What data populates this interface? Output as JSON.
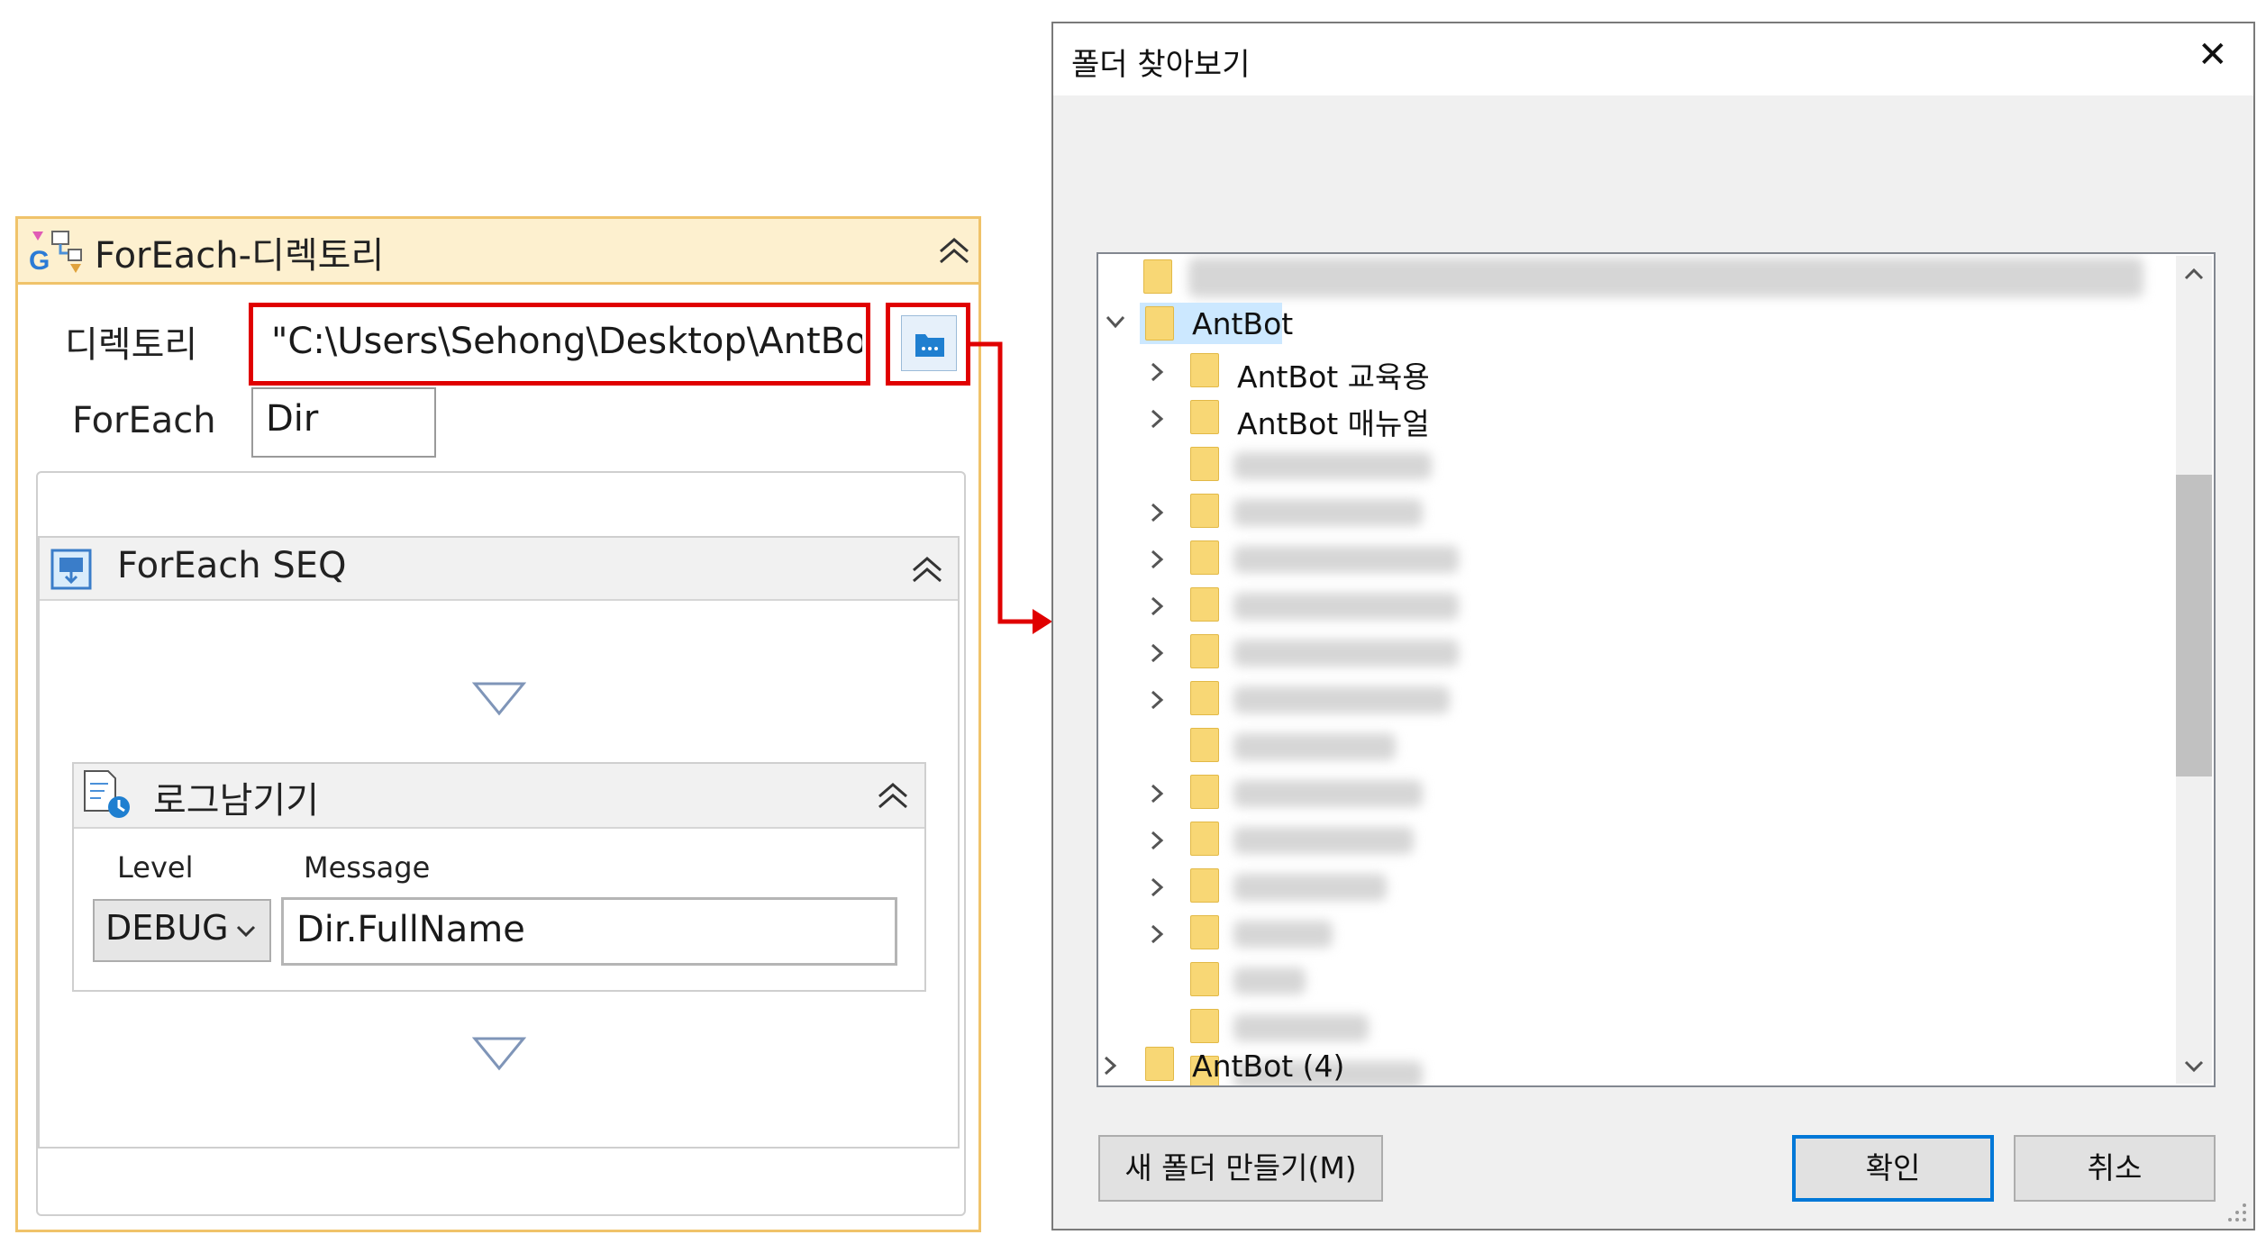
{
  "foreach_activity": {
    "title": "ForEach-디렉토리",
    "directory_label": "디렉토리",
    "directory_value": "\"C:\\Users\\Sehong\\Desktop\\AntBot\"",
    "foreach_label": "ForEach",
    "foreach_value": "Dir",
    "sequence": {
      "title": "ForEach SEQ",
      "log_activity": {
        "title": "로그남기기",
        "level_label": "Level",
        "message_label": "Message",
        "level_value": "DEBUG",
        "message_value": "Dir.FullName"
      }
    }
  },
  "dialog": {
    "title": "폴더 찾아보기",
    "close_glyph": "✕",
    "tree": {
      "root_selected": "AntBot",
      "children": [
        "AntBot 교육용",
        "AntBot 매뉴얼"
      ],
      "bottom_item": "AntBot (4)"
    },
    "buttons": {
      "new_folder": "새 폴더 만들기(M)",
      "ok": "확인",
      "cancel": "취소"
    }
  },
  "colors": {
    "highlight_red": "#e00000",
    "activity_border": "#f0c36a",
    "activity_header": "#fdf0cf",
    "selection": "#cce8ff",
    "accent": "#0078d7"
  }
}
